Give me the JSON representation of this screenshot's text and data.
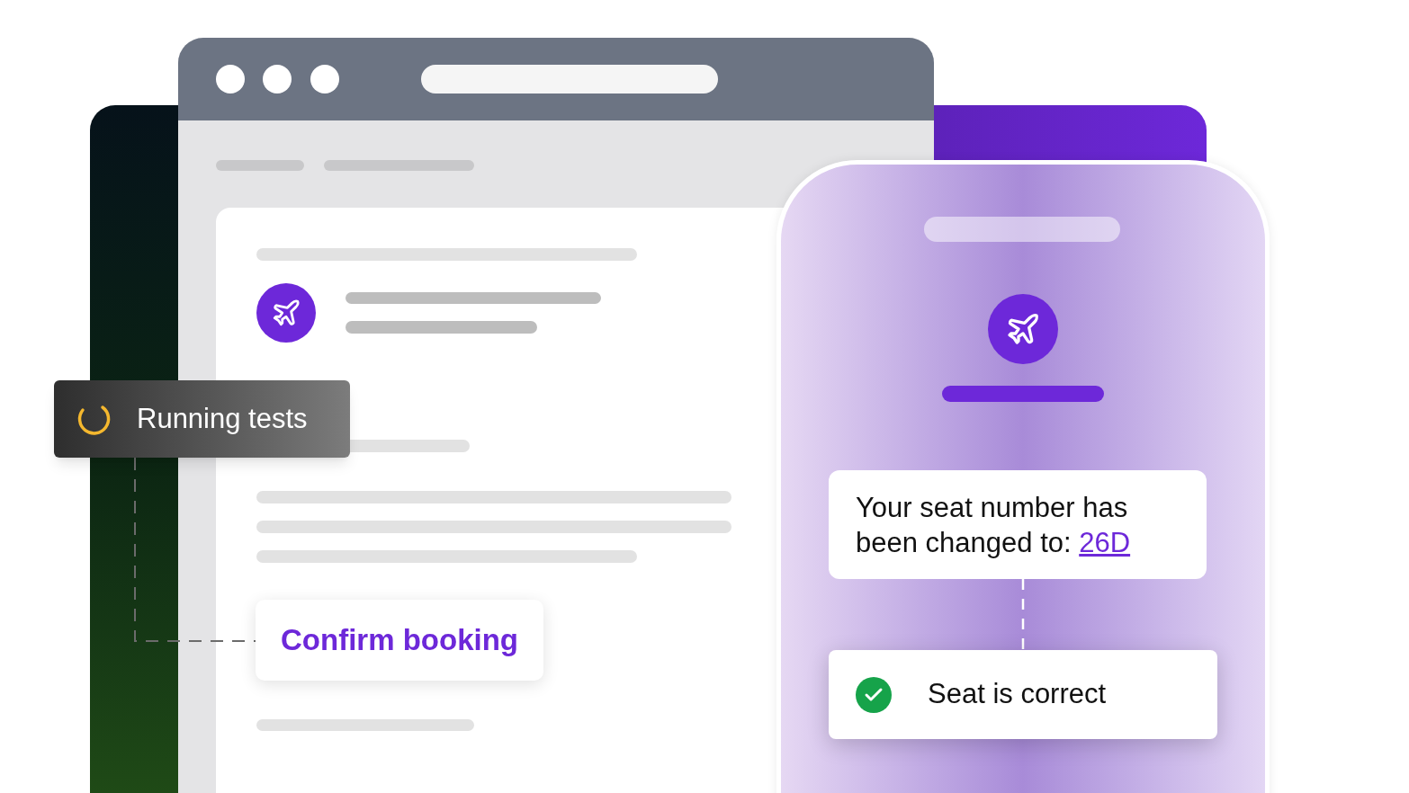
{
  "status_badge": {
    "label": "Running tests",
    "running": true
  },
  "confirm_button": {
    "label": "Confirm booking"
  },
  "phone": {
    "message": {
      "text": "Your seat number has been changed to:",
      "link": "26D"
    },
    "check": {
      "label": "Seat is correct",
      "passed": true
    }
  }
}
